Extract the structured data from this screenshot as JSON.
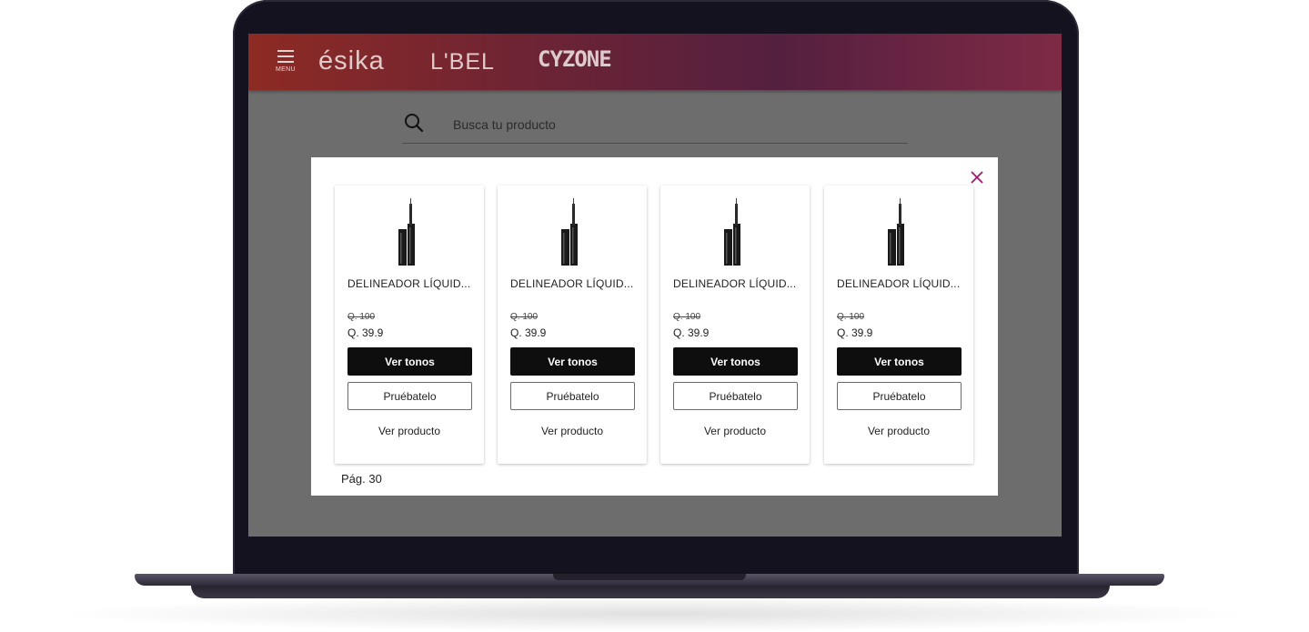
{
  "header": {
    "menu_label": "MENU",
    "brands": [
      "ésika",
      "L'BEL",
      "CYZONE"
    ]
  },
  "search": {
    "placeholder": "Busca tu producto",
    "value": ""
  },
  "modal": {
    "products": [
      {
        "name": "DELINEADOR LÍQUID...",
        "price_old": "Q. 100",
        "price_new": "Q. 39.9",
        "primary_label": "Ver tonos",
        "secondary_label": "Pruébatelo",
        "link_label": "Ver producto"
      },
      {
        "name": "DELINEADOR LÍQUID...",
        "price_old": "Q. 100",
        "price_new": "Q. 39.9",
        "primary_label": "Ver tonos",
        "secondary_label": "Pruébatelo",
        "link_label": "Ver producto"
      },
      {
        "name": "DELINEADOR LÍQUID...",
        "price_old": "Q. 100",
        "price_new": "Q. 39.9",
        "primary_label": "Ver tonos",
        "secondary_label": "Pruébatelo",
        "link_label": "Ver producto"
      },
      {
        "name": "DELINEADOR LÍQUID...",
        "price_old": "Q. 100",
        "price_new": "Q. 39.9",
        "primary_label": "Ver tonos",
        "secondary_label": "Pruébatelo",
        "link_label": "Ver producto"
      }
    ],
    "page_label": "Pág. 30"
  },
  "colors": {
    "close_accent": "#a0186e",
    "header_start": "#8d2a24",
    "header_end": "#54203f"
  }
}
